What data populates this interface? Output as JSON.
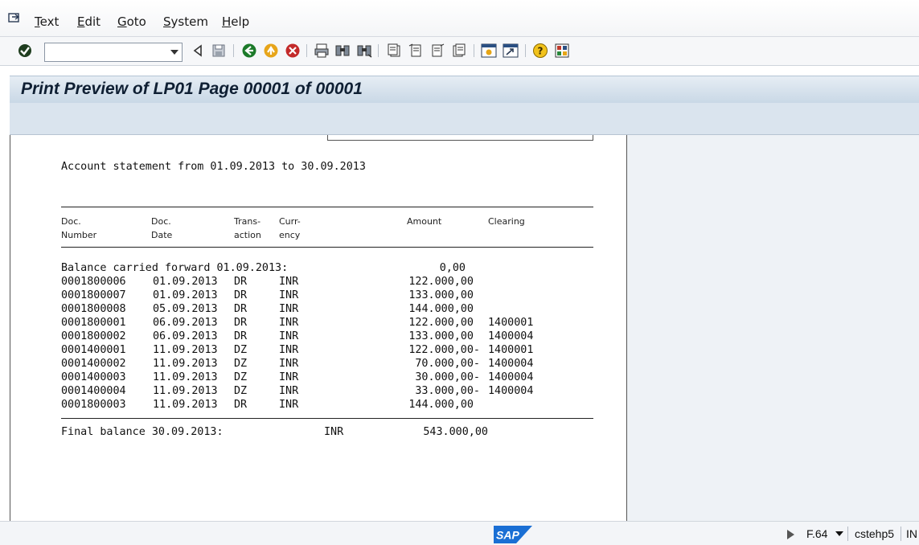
{
  "menu": {
    "items": [
      {
        "label": "Text",
        "accel": "T",
        "rest": "ext"
      },
      {
        "label": "Edit",
        "accel": "E",
        "rest": "dit"
      },
      {
        "label": "Goto",
        "accel": "G",
        "rest": "oto"
      },
      {
        "label": "System",
        "accel": "S",
        "rest": "ystem"
      },
      {
        "label": "Help",
        "accel": "H",
        "rest": "elp"
      }
    ]
  },
  "toolbar": {
    "command_value": ""
  },
  "title": "Print Preview of LP01 Page 00001 of 00001",
  "statement": {
    "heading": "Account statement from 01.09.2013 to 30.09.2013",
    "columns": {
      "doc_number": [
        "Doc.",
        "Number"
      ],
      "doc_date": [
        "Doc.",
        "Date"
      ],
      "transaction": [
        "Trans-",
        "action"
      ],
      "currency": [
        "Curr-",
        "ency"
      ],
      "amount": [
        "Amount"
      ],
      "clearing": [
        "Clearing"
      ]
    },
    "carried_forward": {
      "label": "Balance carried forward 01.09.2013:",
      "amount": "0,00"
    },
    "rows": [
      {
        "doc": "0001800006",
        "date": "01.09.2013",
        "trans": "DR",
        "curr": "INR",
        "amount": "122.000,00",
        "clearing": ""
      },
      {
        "doc": "0001800007",
        "date": "01.09.2013",
        "trans": "DR",
        "curr": "INR",
        "amount": "133.000,00",
        "clearing": ""
      },
      {
        "doc": "0001800008",
        "date": "05.09.2013",
        "trans": "DR",
        "curr": "INR",
        "amount": "144.000,00",
        "clearing": ""
      },
      {
        "doc": "0001800001",
        "date": "06.09.2013",
        "trans": "DR",
        "curr": "INR",
        "amount": "122.000,00",
        "clearing": "1400001"
      },
      {
        "doc": "0001800002",
        "date": "06.09.2013",
        "trans": "DR",
        "curr": "INR",
        "amount": "133.000,00",
        "clearing": "1400004"
      },
      {
        "doc": "0001400001",
        "date": "11.09.2013",
        "trans": "DZ",
        "curr": "INR",
        "amount": "122.000,00-",
        "clearing": "1400001"
      },
      {
        "doc": "0001400002",
        "date": "11.09.2013",
        "trans": "DZ",
        "curr": "INR",
        "amount": "70.000,00-",
        "clearing": "1400004"
      },
      {
        "doc": "0001400003",
        "date": "11.09.2013",
        "trans": "DZ",
        "curr": "INR",
        "amount": "30.000,00-",
        "clearing": "1400004"
      },
      {
        "doc": "0001400004",
        "date": "11.09.2013",
        "trans": "DZ",
        "curr": "INR",
        "amount": "33.000,00-",
        "clearing": "1400004"
      },
      {
        "doc": "0001800003",
        "date": "11.09.2013",
        "trans": "DR",
        "curr": "INR",
        "amount": "144.000,00",
        "clearing": ""
      }
    ],
    "final": {
      "label": "Final balance 30.09.2013:",
      "currency": "INR",
      "amount": "543.000,00"
    }
  },
  "status": {
    "logo": "SAP",
    "transaction": "F.64",
    "server": "cstehp5",
    "mode": "IN"
  },
  "icons": {
    "check": "green-check-icon",
    "back": "back-icon",
    "exit": "exit-icon",
    "cancel": "cancel-icon"
  }
}
